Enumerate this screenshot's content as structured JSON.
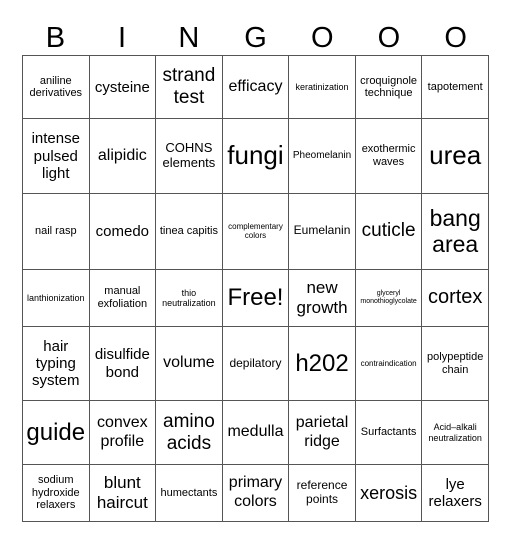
{
  "header": [
    "B",
    "I",
    "N",
    "G",
    "O",
    "O",
    "O"
  ],
  "grid": [
    [
      "aniline derivatives",
      "cysteine",
      "strand test",
      "efficacy",
      "keratinization",
      "croquignole technique",
      "tapotement"
    ],
    [
      "intense pulsed light",
      "alipidic",
      "COHNS elements",
      "fungi",
      "Pheomelanin",
      "exothermic waves",
      "urea"
    ],
    [
      "nail rasp",
      "comedo",
      "tinea capitis",
      "complementary colors",
      "Eumelanin",
      "cuticle",
      "bang area"
    ],
    [
      "lanthionization",
      "manual exfoliation",
      "thio neutralization",
      "Free!",
      "new growth",
      "glyceryl monothioglycolate",
      "cortex"
    ],
    [
      "hair typing system",
      "disulfide bond",
      "volume",
      "depilatory",
      "h202",
      "contraindication",
      "polypeptide chain"
    ],
    [
      "guide",
      "convex profile",
      "amino acids",
      "medulla",
      "parietal ridge",
      "Surfactants",
      "Acid–alkali neutralization"
    ],
    [
      "sodium hydroxide relaxers",
      "blunt haircut",
      "humectants",
      "primary colors",
      "reference points",
      "xerosis",
      "lye relaxers"
    ]
  ]
}
